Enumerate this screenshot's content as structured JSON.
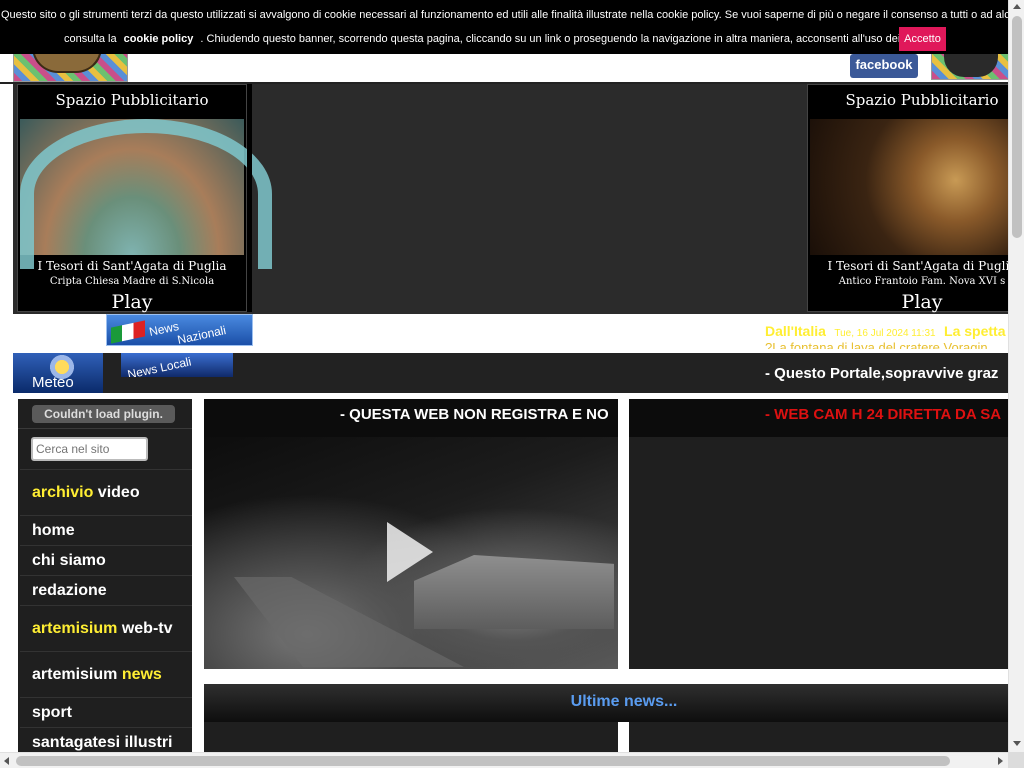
{
  "cookie_banner": {
    "line1": "Questo sito o gli strumenti terzi da questo utilizzati si avvalgono di cookie necessari al funzionamento ed utili alle finalità illustrate nella cookie policy. Se vuoi saperne di più o negare il consenso a tutti o ad alcuni cookie,",
    "line2_prefix": "consulta la",
    "policy_link": "cookie policy",
    "line2_suffix": ". Chiudendo questo banner, scorrendo questa pagina, cliccando su un link o proseguendo la navigazione in altra maniera, acconsenti all'uso dei cookie",
    "accept_label": "Accetto"
  },
  "header": {
    "facebook_label": "facebook"
  },
  "ads": {
    "left": {
      "title": "Spazio Pubblicitario",
      "caption1": "I Tesori di Sant'Agata di Puglia",
      "caption2": "Cripta Chiesa Madre di S.Nicola",
      "play_label": "Play"
    },
    "right": {
      "title": "Spazio Pubblicitario",
      "caption1": "I Tesori di Sant'Agata di Puglia",
      "caption2": "Antico Frantoio Fam. Nova XVI s",
      "play_label": "Play"
    }
  },
  "news_bar": {
    "nazionali_label1": "News",
    "nazionali_label2": "Nazionali",
    "italia_label": "Dall'Italia",
    "italia_date": "Tue, 16 Jul 2024 11:31",
    "italia_headline": "La spetta",
    "italia_line2": "?La fontana di lava del cratere Voragin"
  },
  "local_bar": {
    "meteo_label": "Meteo",
    "locali_label": "News Locali",
    "ticker_text": "- Questo Portale,sopravvive graz"
  },
  "sidebar": {
    "plugin_notice": "Couldn't load plugin.",
    "search_placeholder": "Cerca nel sito",
    "items": [
      {
        "label": "archivio",
        "label2": " video",
        "highlight": "first"
      },
      {
        "label": "home"
      },
      {
        "label": "chi siamo"
      },
      {
        "label": "redazione"
      },
      {
        "label": "artemisium",
        "label2": " web-tv",
        "highlight": "first"
      },
      {
        "label": "artemisium ",
        "label2": "news",
        "highlight": "second"
      },
      {
        "label": "sport"
      },
      {
        "label": "santagatesi illustri"
      }
    ]
  },
  "panels": {
    "left_title": "- QUESTA WEB NON REGISTRA E NO",
    "right_title": "- WEB CAM H 24 DIRETTA DA SA",
    "ultime_news": "Ultime news..."
  },
  "colors": {
    "accent_yellow": "#ffee33",
    "accept_button": "#e0185a",
    "ultime_blue": "#5a9cf0",
    "webcam_red": "#dd1111"
  },
  "icons": {
    "play": "play-icon",
    "meteo": "weather-icon",
    "flag": "italy-flag-icon"
  }
}
